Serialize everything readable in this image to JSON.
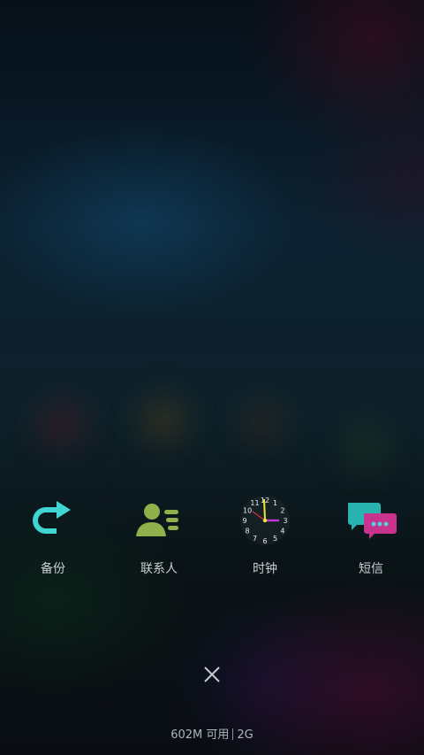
{
  "apps": [
    {
      "label": "备份",
      "icon": "backup-icon"
    },
    {
      "label": "联系人",
      "icon": "contacts-icon"
    },
    {
      "label": "时钟",
      "icon": "clock-icon"
    },
    {
      "label": "短信",
      "icon": "messages-icon"
    }
  ],
  "clock_numbers": [
    "12",
    "1",
    "2",
    "3",
    "4",
    "5",
    "6",
    "7",
    "8",
    "9",
    "10",
    "11"
  ],
  "close_icon": "close-icon",
  "memory": {
    "free": "602M 可用",
    "total": "2G"
  },
  "colors": {
    "backup": "#3fd5d0",
    "contacts": "#8fb04a",
    "sms_back": "#27b3b0",
    "sms_front": "#c8338e",
    "clock_hour": "#f2e43a",
    "clock_minute": "#c23ad6"
  }
}
